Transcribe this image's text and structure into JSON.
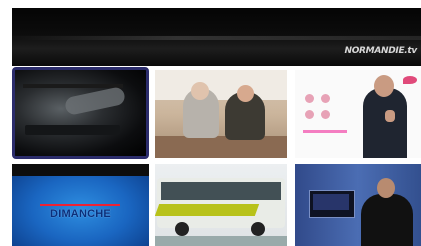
{
  "hero": {
    "channel_logo": "NORMANDIE.tv"
  },
  "thumbnails": [
    {
      "id": "video-1",
      "selected": true,
      "overlay_text": ""
    },
    {
      "id": "video-2",
      "selected": false,
      "overlay_text": ""
    },
    {
      "id": "video-3",
      "selected": false,
      "overlay_text": ""
    },
    {
      "id": "video-4",
      "selected": false,
      "overlay_text": "DIMANCHE"
    },
    {
      "id": "video-5",
      "selected": false,
      "overlay_text": ""
    },
    {
      "id": "video-6",
      "selected": false,
      "overlay_text": ""
    }
  ],
  "colors": {
    "selected_border": "#2b2c6b",
    "hero_background": "#0a0a0a"
  }
}
